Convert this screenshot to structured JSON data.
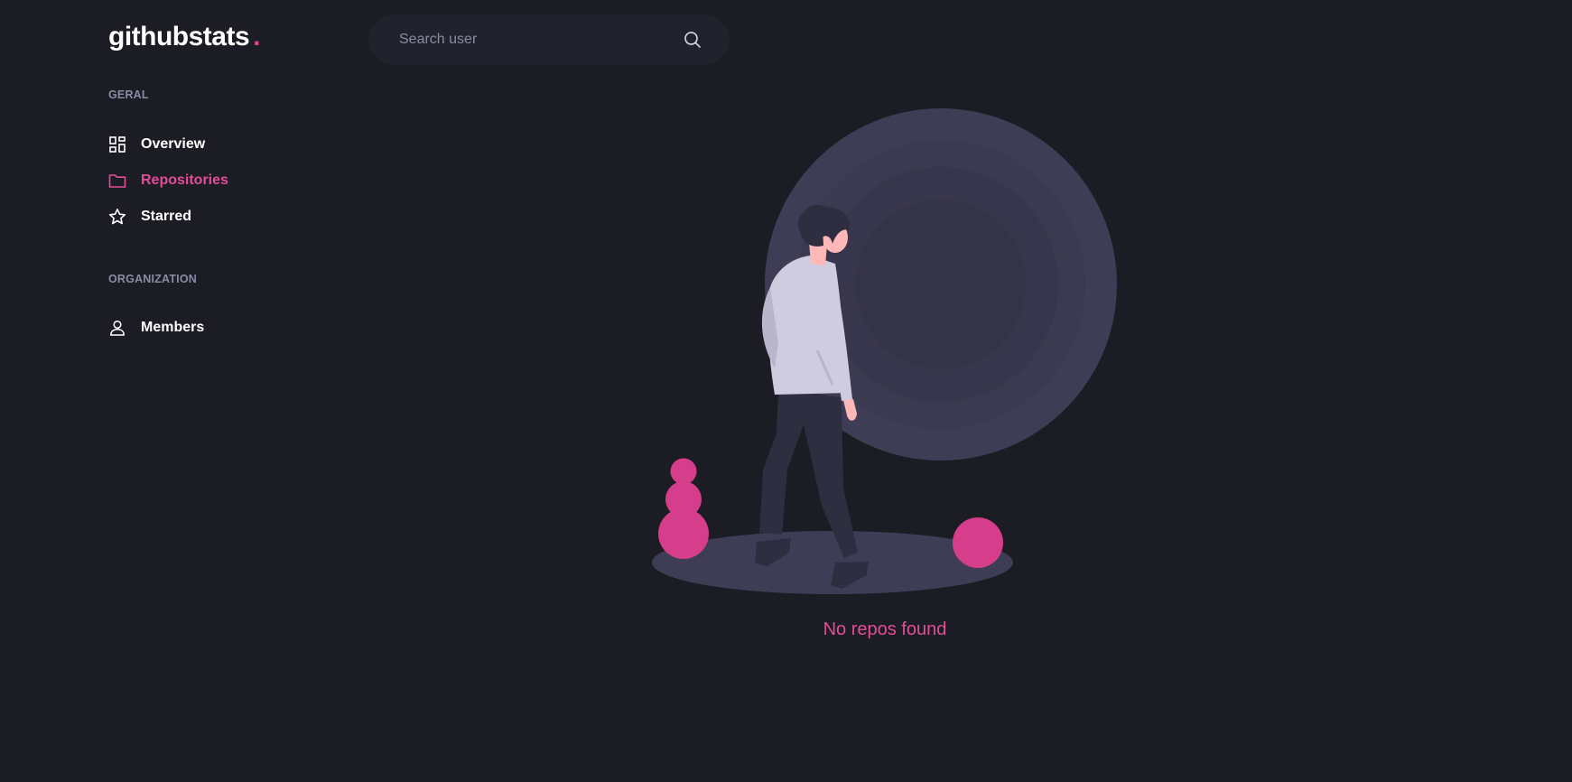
{
  "brand": {
    "name": "githubstats",
    "dot": "."
  },
  "colors": {
    "accent": "#e34d97",
    "background": "#1b1c24",
    "search_bg": "#22222d",
    "muted": "#8b8ba6"
  },
  "search": {
    "placeholder": "Search user",
    "value": "",
    "icon": "search-icon"
  },
  "sidebar": {
    "sections": [
      {
        "title": "GERAL",
        "items": [
          {
            "label": "Overview",
            "icon": "dashboard-icon",
            "active": false
          },
          {
            "label": "Repositories",
            "icon": "folder-icon",
            "active": true
          },
          {
            "label": "Starred",
            "icon": "star-icon",
            "active": false
          }
        ]
      },
      {
        "title": "ORGANIZATION",
        "items": [
          {
            "label": "Members",
            "icon": "user-icon",
            "active": false
          }
        ]
      }
    ]
  },
  "main": {
    "empty_message": "No repos found"
  }
}
